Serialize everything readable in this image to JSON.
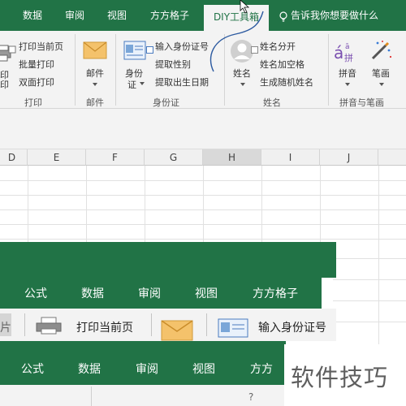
{
  "ribbon": {
    "tabs": [
      {
        "label": "数据"
      },
      {
        "label": "审阅"
      },
      {
        "label": "视图"
      },
      {
        "label": "方方格子"
      },
      {
        "label": "DIY工具箱"
      }
    ],
    "tell_me": "告诉我你想要做什么",
    "print_group": {
      "items": [
        "打印当前页",
        "批量打印",
        "双面打印"
      ],
      "left_fragments": [
        "印",
        "印"
      ],
      "label": "打印"
    },
    "mail_group": {
      "button": "邮件",
      "label": "邮件"
    },
    "id_group": {
      "button_line1": "身份",
      "button_line2": "证",
      "items": [
        "输入身份证号",
        "提取性别",
        "提取出生日期"
      ],
      "label": "身份证"
    },
    "name_group": {
      "button": "姓名",
      "items": [
        "姓名分开",
        "姓名加空格",
        "生成随机姓名"
      ],
      "label": "姓名"
    },
    "pinyin_group": {
      "pinyin_button": "拼音",
      "stroke_button": "笔画",
      "label": "拼音与笔画",
      "pinyin_icon_text": "拼"
    }
  },
  "sheet": {
    "columns": [
      "D",
      "E",
      "F",
      "G",
      "H",
      "I",
      "J"
    ]
  },
  "zoom_overlay": {
    "tabs_upper": [
      "公式",
      "数据",
      "审阅",
      "视图",
      "方方格子"
    ],
    "buttons": [
      "打印当前页",
      "输入身份证号"
    ],
    "left_fragment": "片",
    "tabs_lower": [
      "公式",
      "数据",
      "审阅",
      "视图",
      "方方"
    ],
    "question_mark": "?"
  },
  "watermark": "软件技巧",
  "colors": {
    "excel_green": "#217346",
    "ribbon_bg": "#f3f3f3",
    "annotation_stroke": "#2c5aa0"
  }
}
